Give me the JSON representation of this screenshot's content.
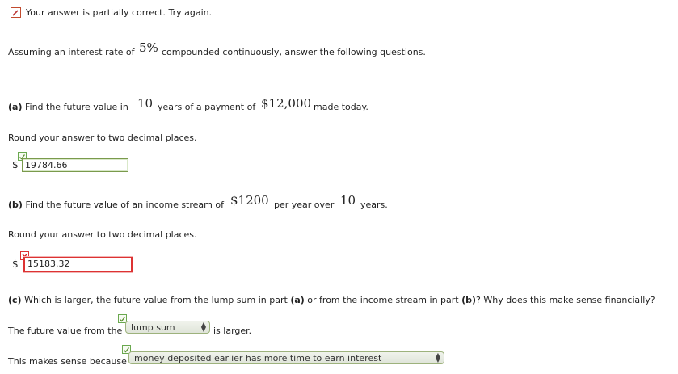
{
  "banner": {
    "text": "Your answer is partially correct.  Try again."
  },
  "intro": {
    "prefix": "Assuming an interest rate of",
    "rate": "5%",
    "suffix": "compounded continuously, answer the following questions."
  },
  "part_a": {
    "label": "(a)",
    "prefix": "Find the future value in",
    "years": "10",
    "middle": "years of a payment of",
    "amount": "$12,000",
    "suffix": "made today.",
    "round_note": "Round your answer to two decimal places.",
    "currency": "$",
    "answer": "19784.66"
  },
  "part_b": {
    "label": "(b)",
    "prefix": "Find the future value of an income stream of",
    "amount": "$1200",
    "middle": "per year over",
    "years": "10",
    "suffix": "years.",
    "round_note": "Round your answer to two decimal places.",
    "currency": "$",
    "answer": "15183.32"
  },
  "part_c": {
    "label": "(c)",
    "q1": "Which is larger, the future value from the lump sum in part",
    "ref_a": "(a)",
    "q2": "or from the income stream in part",
    "ref_b": "(b)",
    "q3": "? Why does this make sense financially?",
    "line1_prefix": "The future value from the",
    "line1_select": "lump sum",
    "line1_suffix": "is larger.",
    "line2_prefix": "This makes sense because",
    "line2_select": "money deposited earlier has more time to earn interest"
  }
}
